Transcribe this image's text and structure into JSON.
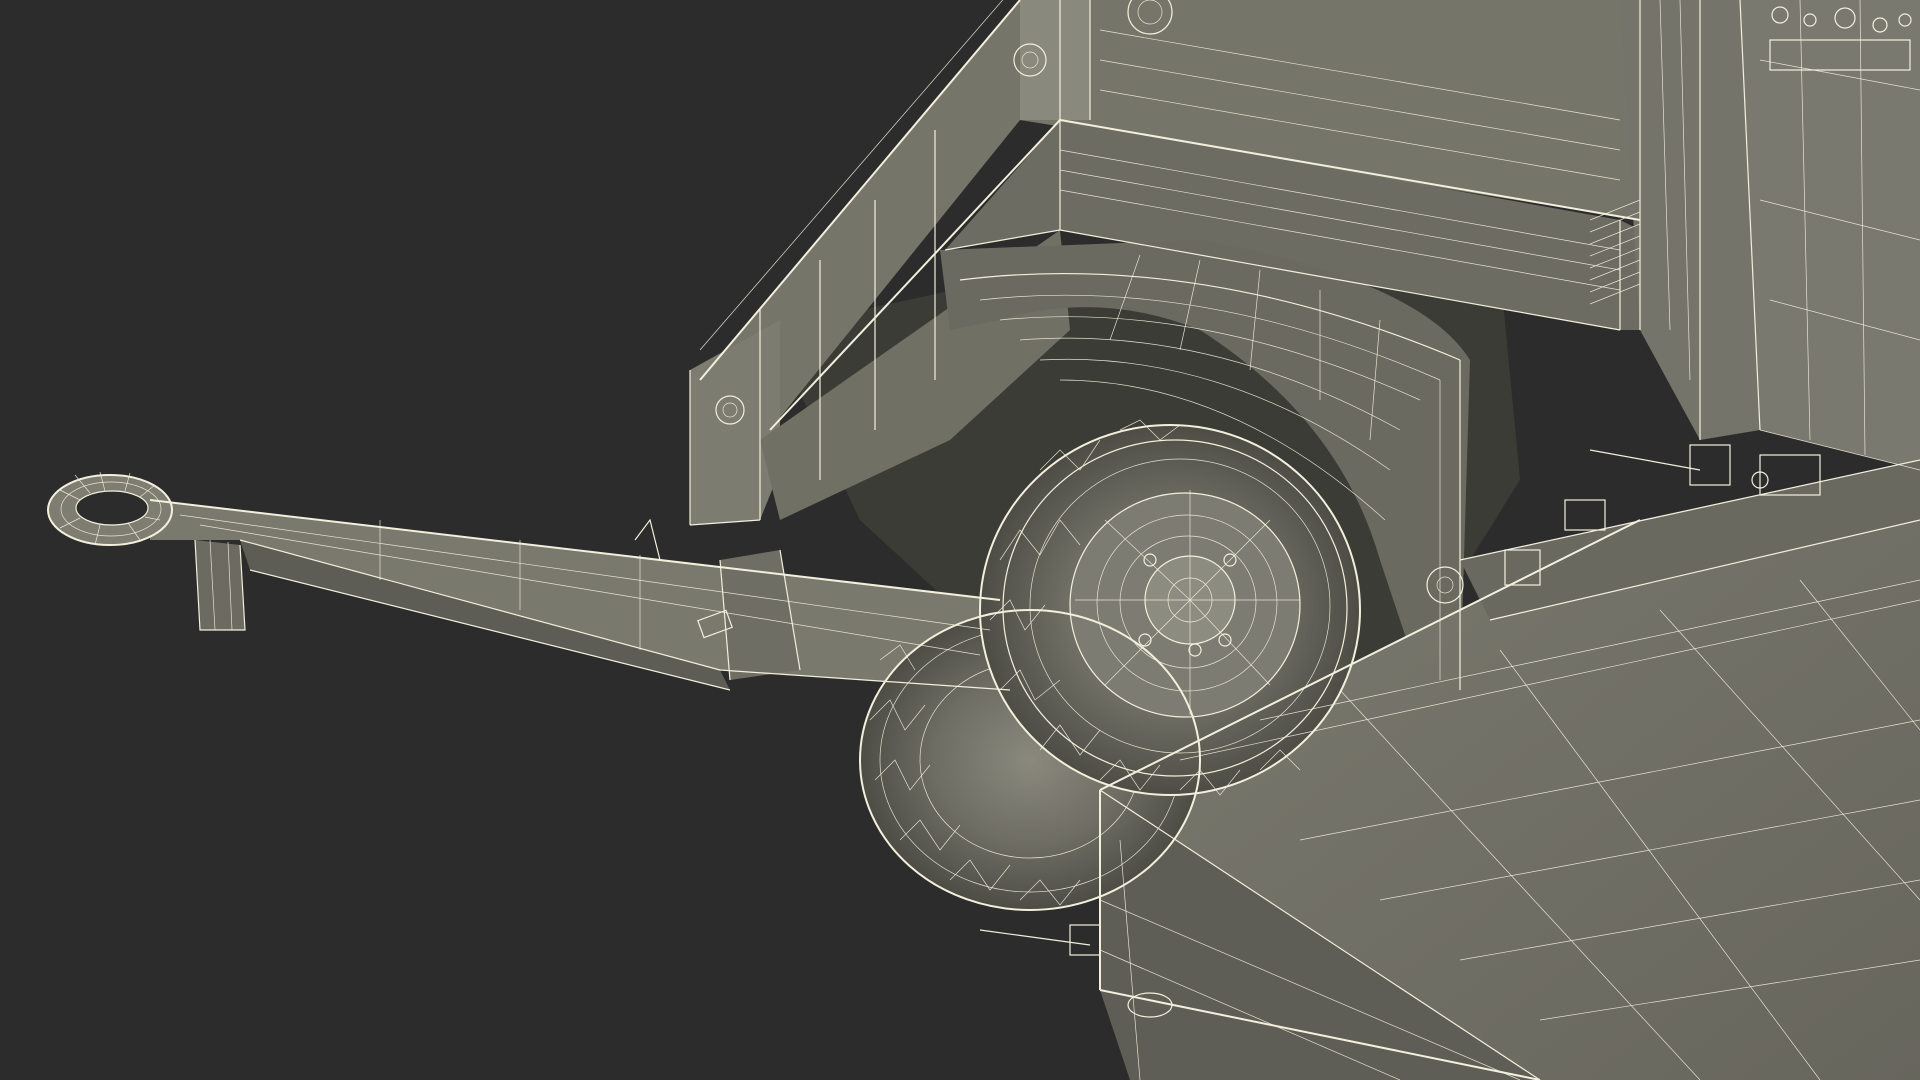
{
  "image": {
    "description_text": "",
    "palette": {
      "background": "#2c2c2c",
      "surface_light": "#7f7e72",
      "surface_mid": "#6e6d63",
      "surface_dark": "#55554d",
      "shadow": "#3d3d38",
      "wire": "#f2f0dc"
    }
  }
}
